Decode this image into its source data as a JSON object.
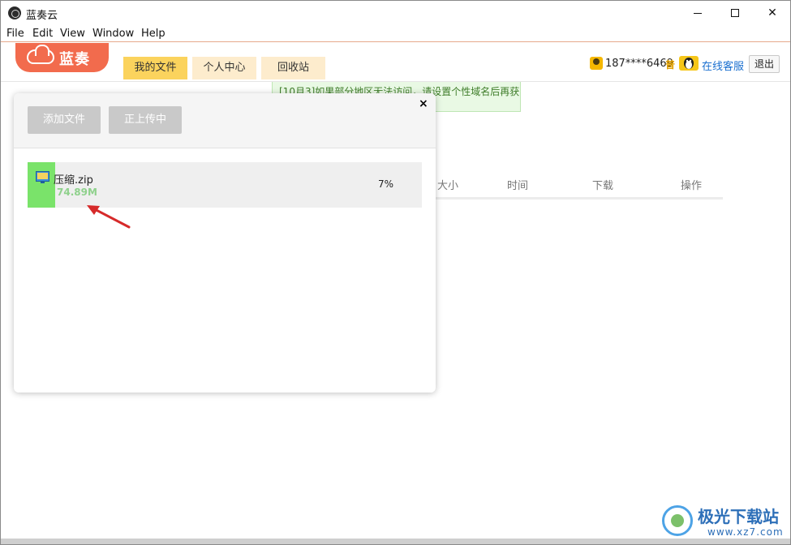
{
  "window": {
    "title": "蓝奏云"
  },
  "menu": {
    "items": [
      "File",
      "Edit",
      "View",
      "Window",
      "Help"
    ]
  },
  "header": {
    "logo_text": "蓝奏",
    "tabs": [
      {
        "label": "我的文件",
        "active": true
      },
      {
        "label": "个人中心",
        "active": false
      },
      {
        "label": "回收站",
        "active": false
      }
    ],
    "user": {
      "name": "187****6469",
      "level": "普",
      "service_link": "在线客服",
      "logout": "退出"
    }
  },
  "notice": {
    "text": "[10月3]如果部分地区无法访问，请设置个性域名后再获"
  },
  "table": {
    "headers": [
      "大小",
      "时间",
      "下载",
      "操作"
    ]
  },
  "upload_dialog": {
    "close": "×",
    "add_button": "添加文件",
    "status_button": "正上传中",
    "file": {
      "name": "压缩.zip",
      "size": "74.89M",
      "percent_text": "7%",
      "progress": 0.07
    }
  },
  "watermark": {
    "title": "极光下载站",
    "url": "www.xz7.com"
  },
  "colors": {
    "accent_orange": "#f26b4d",
    "tab_active": "#fbd35d",
    "tab_inactive": "#fdeccd",
    "progress_green": "#7ae36a",
    "link_blue": "#1a6fcf"
  }
}
